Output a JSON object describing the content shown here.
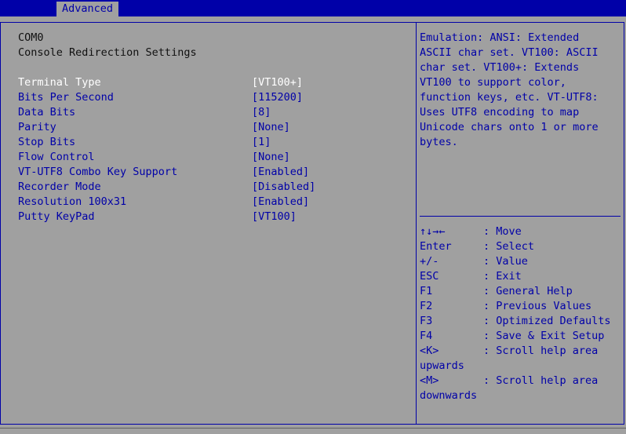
{
  "header": {
    "active_tab": "Advanced"
  },
  "main": {
    "section_title": "COM0",
    "subtitle": "Console Redirection Settings",
    "settings": [
      {
        "label": "Terminal Type",
        "value": "[VT100+]",
        "selected": true
      },
      {
        "label": "Bits Per Second",
        "value": "[115200]"
      },
      {
        "label": "Data Bits",
        "value": "[8]"
      },
      {
        "label": "Parity",
        "value": "[None]"
      },
      {
        "label": "Stop Bits",
        "value": "[1]"
      },
      {
        "label": "Flow Control",
        "value": "[None]"
      },
      {
        "label": "VT-UTF8 Combo Key Support",
        "value": "[Enabled]"
      },
      {
        "label": "Recorder Mode",
        "value": "[Disabled]"
      },
      {
        "label": "Resolution 100x31",
        "value": "[Enabled]"
      },
      {
        "label": "Putty KeyPad",
        "value": "[VT100]"
      }
    ]
  },
  "help": {
    "text": "Emulation: ANSI: Extended\nASCII char set. VT100: ASCII\nchar set. VT100+: Extends\nVT100 to support color,\nfunction keys, etc. VT-UTF8:\nUses UTF8 encoding to map\nUnicode chars onto 1 or more\nbytes."
  },
  "keys": [
    {
      "key": "↑↓→←",
      "desc": ": Move"
    },
    {
      "key": "Enter",
      "desc": ": Select"
    },
    {
      "key": "+/-",
      "desc": ": Value"
    },
    {
      "key": "ESC",
      "desc": ": Exit"
    },
    {
      "key": "F1",
      "desc": ": General Help"
    },
    {
      "key": "F2",
      "desc": ": Previous Values"
    },
    {
      "key": "F3",
      "desc": ": Optimized Defaults"
    },
    {
      "key": "F4",
      "desc": ": Save & Exit Setup"
    },
    {
      "key": "<K>",
      "desc": ": Scroll help area",
      "wrap": "upwards"
    },
    {
      "key": "<M>",
      "desc": ": Scroll help area",
      "wrap": "downwards"
    }
  ],
  "colors": {
    "frame_blue": "#0000a8",
    "background": "#a0a0a0",
    "selected_text": "#ffffff"
  }
}
